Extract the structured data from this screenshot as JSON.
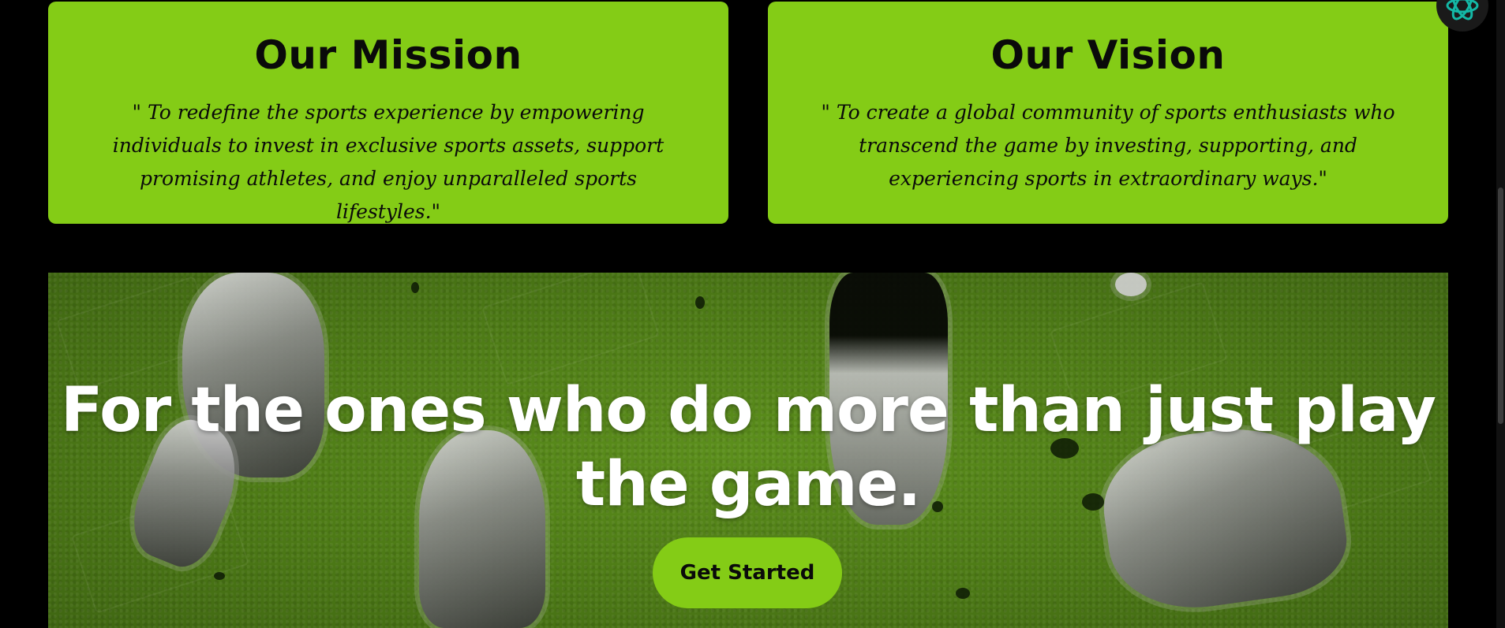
{
  "mission": {
    "title": "Our Mission",
    "text": "\" To redefine the sports experience by empowering individuals to invest in exclusive sports assets, support promising athletes, and enjoy unparalleled sports lifestyles.\""
  },
  "vision": {
    "title": "Our Vision",
    "text": "\" To create a global community of sports enthusiasts who transcend the game by investing, supporting, and experiencing sports in extraordinary ways.\""
  },
  "hero": {
    "headline": "For the ones who do more than just play the game.",
    "cta_label": "Get Started"
  },
  "colors": {
    "accent": "#84cc16",
    "background": "#000000",
    "hero_green": "#4d7a16",
    "fab_icon": "#14b8a6"
  },
  "icons": {
    "assistant": "atom-icon"
  }
}
